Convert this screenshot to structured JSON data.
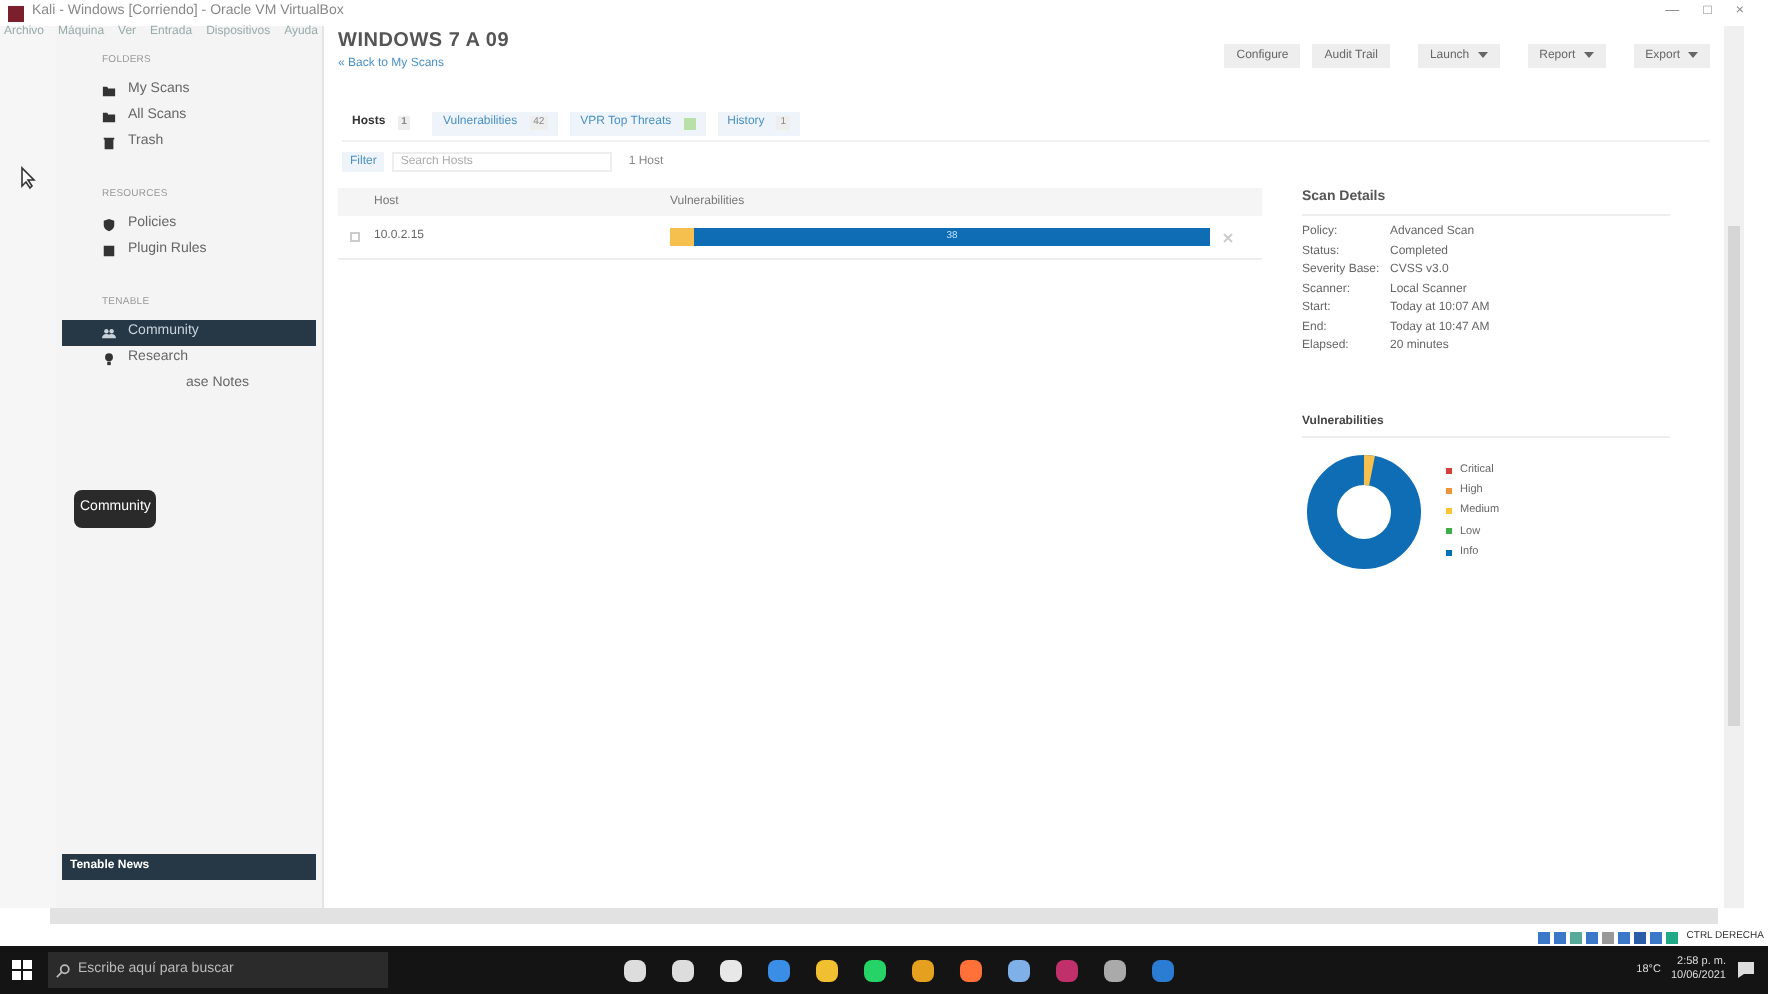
{
  "window": {
    "title": "Kali - Windows [Corriendo] - Oracle VM VirtualBox",
    "controls": [
      "—",
      "□",
      "×"
    ]
  },
  "menu": [
    "Archivo",
    "Máquina",
    "Ver",
    "Entrada",
    "Dispositivos",
    "Ayuda"
  ],
  "sidebar": {
    "sections": [
      {
        "heading": "FOLDERS",
        "items": [
          {
            "label": "My Scans",
            "kind": "folder",
            "selected": false
          },
          {
            "label": "All Scans",
            "kind": "folder",
            "selected": false
          },
          {
            "label": "Trash",
            "kind": "trash",
            "selected": false
          }
        ]
      },
      {
        "heading": "RESOURCES",
        "items": [
          {
            "label": "Policies",
            "kind": "shield",
            "selected": false
          },
          {
            "label": "Plugin Rules",
            "kind": "list",
            "selected": false
          }
        ]
      },
      {
        "heading": "TENABLE",
        "items": [
          {
            "label": "Community",
            "kind": "people",
            "selected": true
          },
          {
            "label": "Research",
            "kind": "bulb",
            "selected": false
          },
          {
            "label": "ase Notes",
            "kind": "plain",
            "selected": false
          }
        ]
      }
    ],
    "tooltip": "Community",
    "news": "Tenable News"
  },
  "header": {
    "title": "WINDOWS 7 A 09",
    "back_link": "« Back to My Scans",
    "buttons": [
      {
        "label": "Configure",
        "dropdown": false
      },
      {
        "label": "Audit Trail",
        "dropdown": false
      },
      {
        "label": "Launch",
        "dropdown": true
      },
      {
        "label": "Report",
        "dropdown": true
      },
      {
        "label": "Export",
        "dropdown": true
      }
    ]
  },
  "tabs": [
    {
      "label": "Hosts",
      "count": "1",
      "selected": true
    },
    {
      "label": "Vulnerabilities",
      "count": "42",
      "selected": false
    },
    {
      "label": "VPR Top Threats",
      "selected": false
    },
    {
      "label": "History",
      "count": "1",
      "selected": false
    }
  ],
  "filter": {
    "button": "Filter",
    "placeholder": "Search Hosts",
    "count": "1 Host"
  },
  "table": {
    "columns": [
      "Host",
      "Vulnerabilities"
    ],
    "rows": [
      {
        "host": "10.0.2.15",
        "checked": false,
        "bar_label": "38"
      }
    ]
  },
  "scan_details": {
    "title": "Scan Details",
    "fields": [
      {
        "label": "Policy:",
        "value": "Advanced Scan"
      },
      {
        "label": "Status:",
        "value": "Completed"
      },
      {
        "label": "Severity Base:",
        "value": "CVSS v3.0"
      },
      {
        "label": "Scanner:",
        "value": "Local Scanner"
      },
      {
        "label": "Start:",
        "value": "Today at 10:07 AM"
      },
      {
        "label": "End:",
        "value": "Today at 10:47 AM"
      },
      {
        "label": "Elapsed:",
        "value": "20 minutes"
      }
    ]
  },
  "vulnerabilities": {
    "title": "Vulnerabilities",
    "legend": [
      {
        "label": "Critical",
        "color": "#d43f3a"
      },
      {
        "label": "High",
        "color": "#ee9336"
      },
      {
        "label": "Medium",
        "color": "#fdc431"
      },
      {
        "label": "Low",
        "color": "#3fae49"
      },
      {
        "label": "Info",
        "color": "#0071b9"
      }
    ]
  },
  "vbox_status": "CTRL DERECHA",
  "taskbar": {
    "search_placeholder": "Escribe aquí para buscar",
    "temperature": "18°C",
    "time": "2:58 p. m.",
    "date": "10/06/2021"
  }
}
